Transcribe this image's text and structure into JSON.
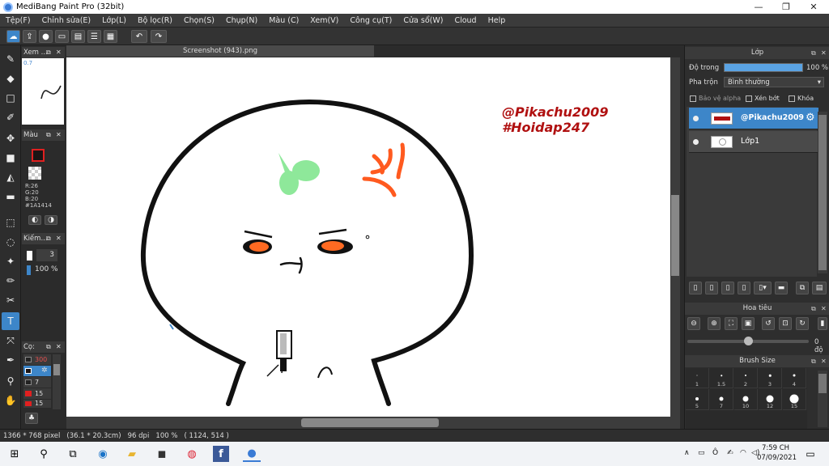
{
  "window": {
    "title": "MediBang Paint Pro (32bit)",
    "min": "—",
    "max": "❐",
    "close": "✕"
  },
  "menu": [
    "Tệp(F)",
    "Chỉnh sửa(E)",
    "Lớp(L)",
    "Bộ lọc(R)",
    "Chọn(S)",
    "Chụp(N)",
    "Màu (C)",
    "Xem(V)",
    "Công cụ(T)",
    "Cửa sổ(W)",
    "Cloud",
    "Help"
  ],
  "document": {
    "tab": "Screenshot (943).png"
  },
  "watermark": {
    "line1": "@Pikachu2009",
    "line2": "#Hoidap247"
  },
  "left_panels": {
    "navigator": {
      "title": "Xem ...",
      "zoom": "0.7"
    },
    "color": {
      "title": "Màu",
      "r": "R:26",
      "g": "G:20",
      "b": "B:20",
      "hex": "#1A1414"
    },
    "pen": {
      "title": "Kiếm...",
      "size": "3",
      "opacity": "100 %"
    },
    "brush": {
      "title": "Cọ:",
      "items": [
        "300",
        "",
        "7",
        "15",
        "15"
      ]
    }
  },
  "layers": {
    "title": "Lớp",
    "opacity_label": "Độ trong",
    "opacity_value": "100 %",
    "opacity": 1.0,
    "blend_label": "Pha trộn",
    "blend_value": "Bình thường",
    "protect_alpha": "Bảo vệ alpha",
    "clipping": "Xén bớt",
    "lock": "Khóa",
    "items": [
      {
        "name": "@Pikachu2009",
        "selected": true
      },
      {
        "name": "Lớp1",
        "selected": false
      }
    ]
  },
  "navigator_panel": {
    "title": "Hoa tiêu",
    "rotation": "0 độ"
  },
  "brush_size": {
    "title": "Brush Size",
    "sizes": [
      "1",
      "1.5",
      "2",
      "3",
      "4",
      "5",
      "7",
      "10",
      "12",
      "15"
    ]
  },
  "status": {
    "text": "1366 * 768 pixel   (36.1 * 20.3cm)   96 dpi   100 %   ( 1124, 514 )"
  },
  "taskbar": {
    "time": "7:59 CH",
    "date": "07/09/2021"
  },
  "colors": {
    "accent": "#3d86c9",
    "panel": "#2e2e2e",
    "watermark": "#b01010",
    "leaf": "#8ee89a",
    "anger": "#ff5a1f"
  }
}
